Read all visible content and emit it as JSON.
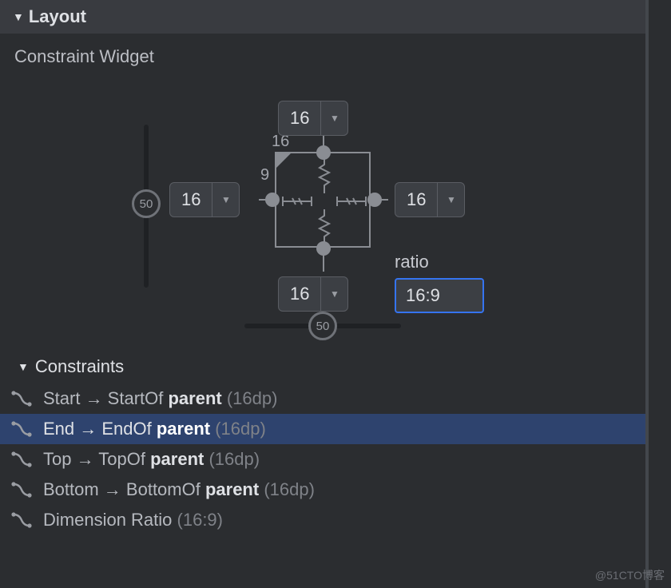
{
  "section": {
    "title": "Layout"
  },
  "widget": {
    "title": "Constraint Widget",
    "margins": {
      "top": "16",
      "bottom": "16",
      "start": "16",
      "end": "16"
    },
    "ratio_numer": "16",
    "ratio_denom": "9",
    "bias_h": "50",
    "bias_v": "50",
    "ratio_label": "ratio",
    "ratio_value": "16:9"
  },
  "constraints_section": {
    "title": "Constraints"
  },
  "constraints": [
    {
      "side": "Start",
      "rel": "StartOf",
      "target": "parent",
      "dp": "(16dp)",
      "selected": false
    },
    {
      "side": "End",
      "rel": "EndOf",
      "target": "parent",
      "dp": "(16dp)",
      "selected": true
    },
    {
      "side": "Top",
      "rel": "TopOf",
      "target": "parent",
      "dp": "(16dp)",
      "selected": false
    },
    {
      "side": "Bottom",
      "rel": "BottomOf",
      "target": "parent",
      "dp": "(16dp)",
      "selected": false
    },
    {
      "side": "Dimension Ratio",
      "rel": "",
      "target": "",
      "dp": "(16:9)",
      "selected": false
    }
  ],
  "watermark": "@51CTO博客"
}
